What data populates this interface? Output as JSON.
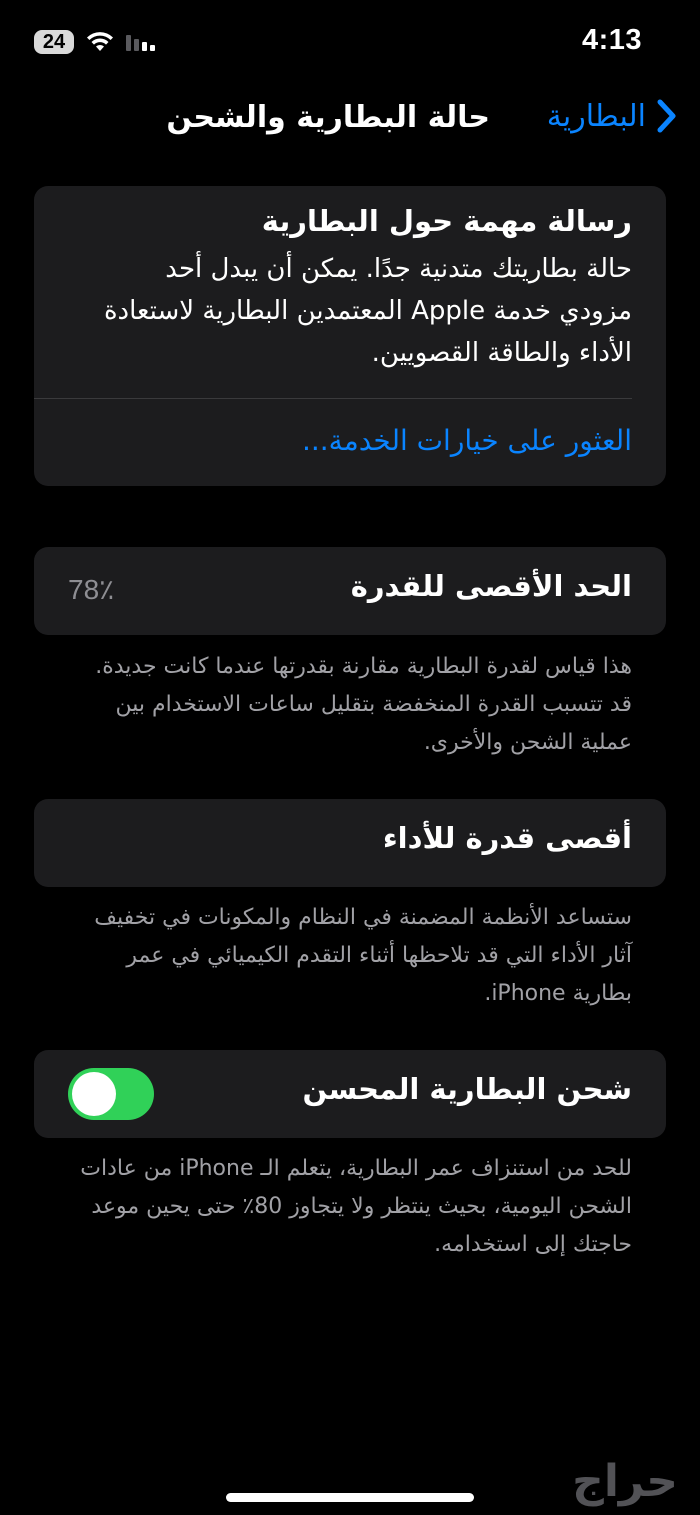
{
  "status_bar": {
    "battery_level": "24",
    "time": "4:13",
    "icons": [
      "battery-icon",
      "wifi-icon",
      "cellular-signal-icon"
    ]
  },
  "nav": {
    "back_label": "البطارية",
    "title": "حالة البطارية والشحن"
  },
  "message_card": {
    "title": "رسالة مهمة حول البطارية",
    "body": "حالة بطاريتك متدنية جدًا. يمكن أن يبدل أحد مزودي خدمة Apple المعتمدين البطارية لاستعادة الأداء والطاقة القصويين.",
    "link": "العثور على خيارات الخدمة..."
  },
  "maximum_capacity": {
    "label": "الحد الأقصى للقدرة",
    "value": "78٪",
    "footnote": "هذا قياس لقدرة البطارية مقارنة بقدرتها عندما كانت جديدة. قد تتسبب القدرة المنخفضة بتقليل ساعات الاستخدام بين عملية الشحن والأخرى."
  },
  "peak_performance": {
    "label": "أقصى قدرة للأداء",
    "footnote": "ستساعد الأنظمة المضمنة في النظام والمكونات في تخفيف آثار الأداء التي قد تلاحظها أثناء التقدم الكيميائي في عمر بطارية iPhone."
  },
  "optimized_charging": {
    "label": "شحن البطارية المحسن",
    "enabled": true,
    "footnote": "للحد من استنزاف عمر البطارية، يتعلم الـ iPhone من عادات الشحن اليومية، بحيث ينتظر ولا يتجاوز 80٪ حتى يحين موعد حاجتك إلى استخدامه."
  },
  "watermark": "حراج",
  "colors": {
    "background": "#000000",
    "card": "#1c1c1e",
    "accent": "#0a84ff",
    "toggle_on": "#30d158",
    "secondary_text": "#a1a1a6"
  }
}
